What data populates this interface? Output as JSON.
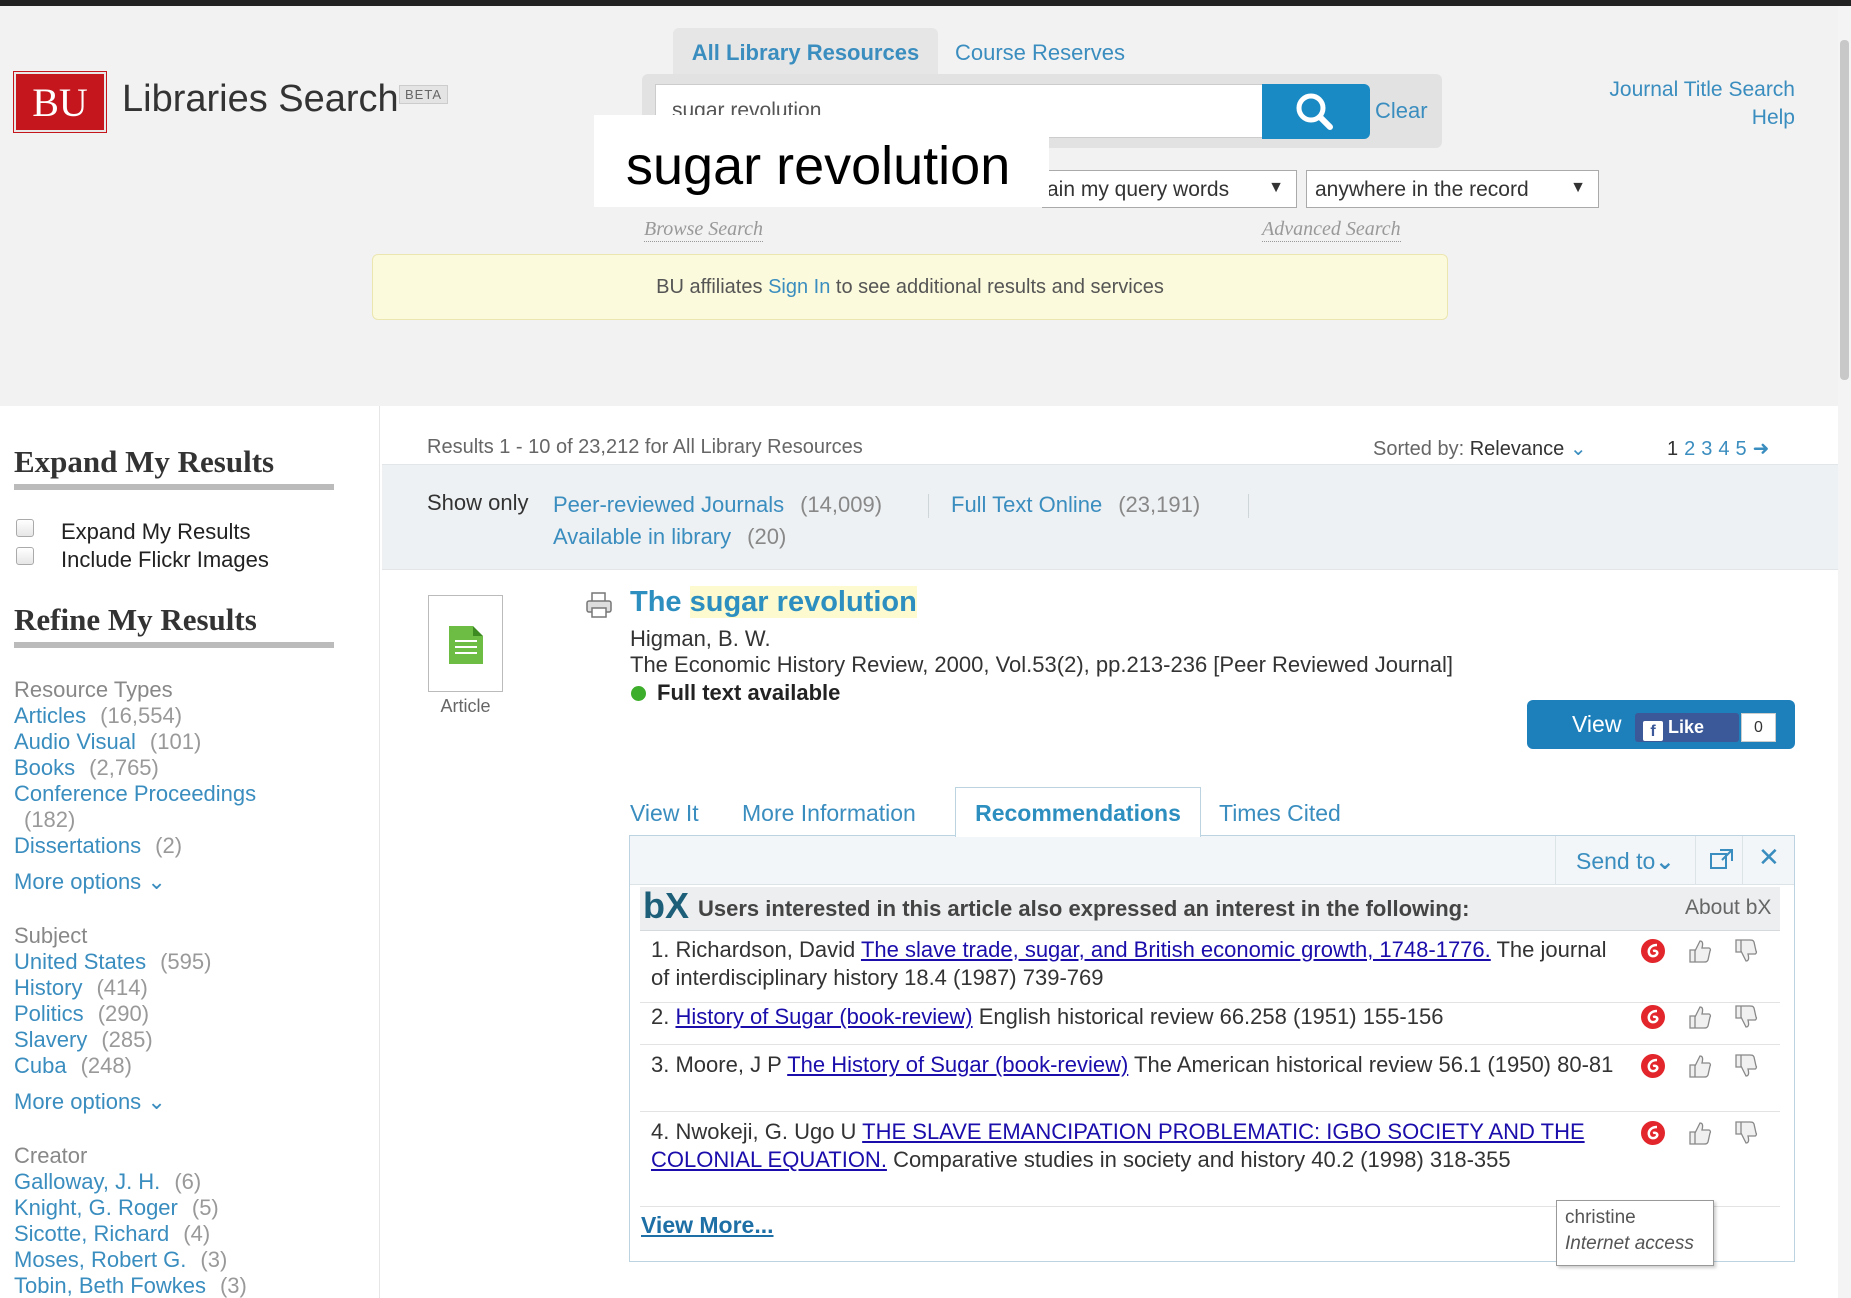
{
  "header": {
    "logo_text": "BU",
    "app_title": "Libraries Search",
    "beta": "BETA",
    "tabs": [
      {
        "label": "All Library Resources",
        "active": true
      },
      {
        "label": "Course Reserves",
        "active": false
      }
    ],
    "search_value": "sugar revolution",
    "clear_label": "Clear",
    "query_overlay": "sugar revolution",
    "match_select": "ain my query words",
    "field_select": "anywhere in the record",
    "browse_search": "Browse Search",
    "advanced_search": "Advanced Search",
    "journal_title_search": "Journal Title Search",
    "help": "Help",
    "signin_prefix": "BU affiliates",
    "signin_link": "Sign In",
    "signin_suffix": "to see additional results and services"
  },
  "sidebar": {
    "expand_heading": "Expand My Results",
    "expand_options": [
      "Expand My Results",
      "Include Flickr Images"
    ],
    "refine_heading": "Refine My Results",
    "more_options": "More options",
    "facets": [
      {
        "heading": "Resource Types",
        "items": [
          {
            "label": "Articles",
            "count": "(16,554)"
          },
          {
            "label": "Audio Visual",
            "count": "(101)"
          },
          {
            "label": "Books",
            "count": "(2,765)"
          },
          {
            "label": "Conference Proceedings",
            "count": "(182)"
          },
          {
            "label": "Dissertations",
            "count": "(2)"
          }
        ]
      },
      {
        "heading": "Subject",
        "items": [
          {
            "label": "United States",
            "count": "(595)"
          },
          {
            "label": "History",
            "count": "(414)"
          },
          {
            "label": "Politics",
            "count": "(290)"
          },
          {
            "label": "Slavery",
            "count": "(285)"
          },
          {
            "label": "Cuba",
            "count": "(248)"
          }
        ]
      },
      {
        "heading": "Creator",
        "items": [
          {
            "label": "Galloway, J. H.",
            "count": "(6)"
          },
          {
            "label": "Knight, G. Roger",
            "count": "(5)"
          },
          {
            "label": "Sicotte, Richard",
            "count": "(4)"
          },
          {
            "label": "Moses, Robert G.",
            "count": "(3)"
          },
          {
            "label": "Tobin, Beth Fowkes",
            "count": "(3)"
          }
        ]
      }
    ]
  },
  "results": {
    "summary": "Results 1 - 10 of 23,212  for All Library Resources",
    "sorted_label": "Sorted by:",
    "sorted_value": "Relevance",
    "pages": [
      "1",
      "2",
      "3",
      "4",
      "5"
    ],
    "show_only_label": "Show only",
    "show_only": [
      {
        "label": "Peer-reviewed Journals",
        "count": "(14,009)"
      },
      {
        "label": "Full Text Online",
        "count": "(23,191)"
      },
      {
        "label": "Available in library",
        "count": "(20)"
      }
    ]
  },
  "record": {
    "type_label": "Article",
    "title_prefix": "The",
    "title_highlight": "sugar revolution",
    "author": "Higman, B. W.",
    "source": "The Economic History Review, 2000, Vol.53(2), pp.213-236 [Peer Reviewed Journal]",
    "availability": "Full text available",
    "view_button": "View",
    "fb_like": "Like",
    "fb_count": "0",
    "tabs": [
      "View It",
      "More Information",
      "Recommendations",
      "Times Cited"
    ],
    "send_to": "Send to"
  },
  "bx": {
    "logo": "bX",
    "heading": "Users interested in this article also expressed an interest in the following:",
    "about": "About bX",
    "items": [
      {
        "num": "1.",
        "author": "Richardson, David",
        "title": "The slave trade, sugar, and British economic growth, 1748-1776.",
        "source": "The journal of interdisciplinary history 18.4 (1987) 739-769"
      },
      {
        "num": "2.",
        "author": "",
        "title": "History of Sugar (book-review)",
        "source": "English historical review 66.258 (1951) 155-156"
      },
      {
        "num": "3.",
        "author": "Moore, J P",
        "title": "The History of Sugar (book-review)",
        "source": "The American historical review 56.1 (1950) 80-81"
      },
      {
        "num": "4.",
        "author": "Nwokeji, G. Ugo U",
        "title": "THE SLAVE EMANCIPATION PROBLEMATIC: IGBO SOCIETY AND THE COLONIAL EQUATION.",
        "source": "Comparative studies in society and history 40.2 (1998) 318-355"
      }
    ],
    "view_more": "View More..."
  },
  "tooltip": {
    "line1": "christine",
    "line2": "Internet access"
  },
  "colors": {
    "brand_red": "#c4161c",
    "link_blue": "#3a8dbf",
    "button_blue": "#1d80bb",
    "notice_yellow": "#fcfadc",
    "fulltext_green": "#3dae2b"
  }
}
